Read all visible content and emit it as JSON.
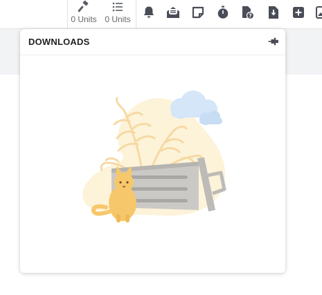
{
  "toolbar": {
    "units": [
      {
        "label": "0 Units",
        "icon": "gavel-icon"
      },
      {
        "label": "0 Units",
        "icon": "list-icon"
      }
    ],
    "icons": [
      "bell-icon",
      "mail-open-icon",
      "sticky-note-icon",
      "stopwatch-icon",
      "file-question-icon",
      "file-download-icon",
      "plus-square-icon",
      "image-icon"
    ]
  },
  "downloads": {
    "title": "DOWNLOADS",
    "pin_icon": "pin-icon"
  },
  "colors": {
    "blob": "#fdf3d9",
    "cat": "#f7c76b",
    "bin": "#c7c5c2",
    "cloud": "#cfe3f7",
    "wheat": "#f8deb0"
  }
}
